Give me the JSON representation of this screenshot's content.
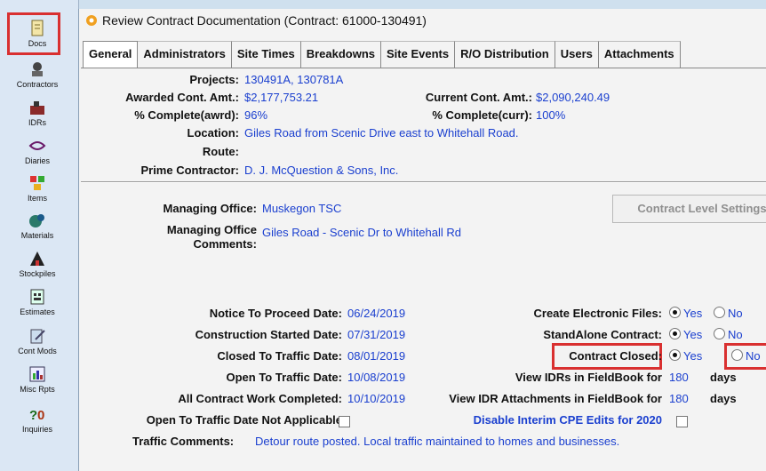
{
  "sidebar": {
    "items": [
      {
        "label": "Docs",
        "icon": "document-icon"
      },
      {
        "label": "Contractors",
        "icon": "contractor-icon"
      },
      {
        "label": "IDRs",
        "icon": "idr-icon"
      },
      {
        "label": "Diaries",
        "icon": "diary-icon"
      },
      {
        "label": "Items",
        "icon": "items-icon"
      },
      {
        "label": "Materials",
        "icon": "materials-icon"
      },
      {
        "label": "Stockpiles",
        "icon": "stockpile-icon"
      },
      {
        "label": "Estimates",
        "icon": "estimates-icon"
      },
      {
        "label": "Cont Mods",
        "icon": "contract-mods-icon"
      },
      {
        "label": "Misc Rpts",
        "icon": "misc-reports-icon"
      },
      {
        "label": "Inquiries",
        "icon": "inquiries-icon"
      }
    ]
  },
  "window": {
    "title": "Review Contract Documentation (Contract: 61000-130491)"
  },
  "tabs": [
    "General",
    "Administrators",
    "Site Times",
    "Breakdowns",
    "Site Events",
    "R/O Distribution",
    "Users",
    "Attachments"
  ],
  "general": {
    "projects_label": "Projects:",
    "projects": "130491A, 130781A",
    "awarded_label": "Awarded Cont. Amt.:",
    "awarded": "$2,177,753.21",
    "current_label": "Current Cont. Amt.:",
    "current": "$2,090,240.49",
    "pct_awrd_label": "% Complete(awrd):",
    "pct_awrd": "96%",
    "pct_curr_label": "% Complete(curr):",
    "pct_curr": "100%",
    "location_label": "Location:",
    "location": "Giles Road from Scenic Drive east to Whitehall Road.",
    "route_label": "Route:",
    "prime_label": "Prime Contractor:",
    "prime": "D. J. McQuestion & Sons, Inc.",
    "office_label": "Managing Office:",
    "office": "Muskegon TSC",
    "office_comments_label_1": "Managing Office",
    "office_comments_label_2": "Comments:",
    "office_comments": "Giles Road - Scenic Dr to Whitehall Rd",
    "settings_button": "Contract Level Settings",
    "ntp_label": "Notice To Proceed Date:",
    "ntp": "06/24/2019",
    "started_label": "Construction Started Date:",
    "started": "07/31/2019",
    "closed_traffic_label": "Closed To Traffic Date:",
    "closed_traffic": "08/01/2019",
    "open_traffic_label": "Open To Traffic Date:",
    "open_traffic": "10/08/2019",
    "all_work_label": "All Contract Work Completed:",
    "all_work": "10/10/2019",
    "open_na_label": "Open To Traffic Date Not Applicable",
    "create_files_label": "Create Electronic Files:",
    "standalone_label": "StandAlone Contract:",
    "contract_closed_label": "Contract Closed:",
    "yes": "Yes",
    "no": "No",
    "view_idrs_label": "View IDRs in FieldBook for",
    "view_idrs": "180",
    "view_att_label": "View IDR Attachments in FieldBook for",
    "view_att": "180",
    "days": "days",
    "disable_cpe_label": "Disable Interim CPE Edits for 2020",
    "traffic_comments_label": "Traffic Comments:",
    "traffic_comments": "Detour route posted.  Local traffic maintained to homes and businesses."
  }
}
